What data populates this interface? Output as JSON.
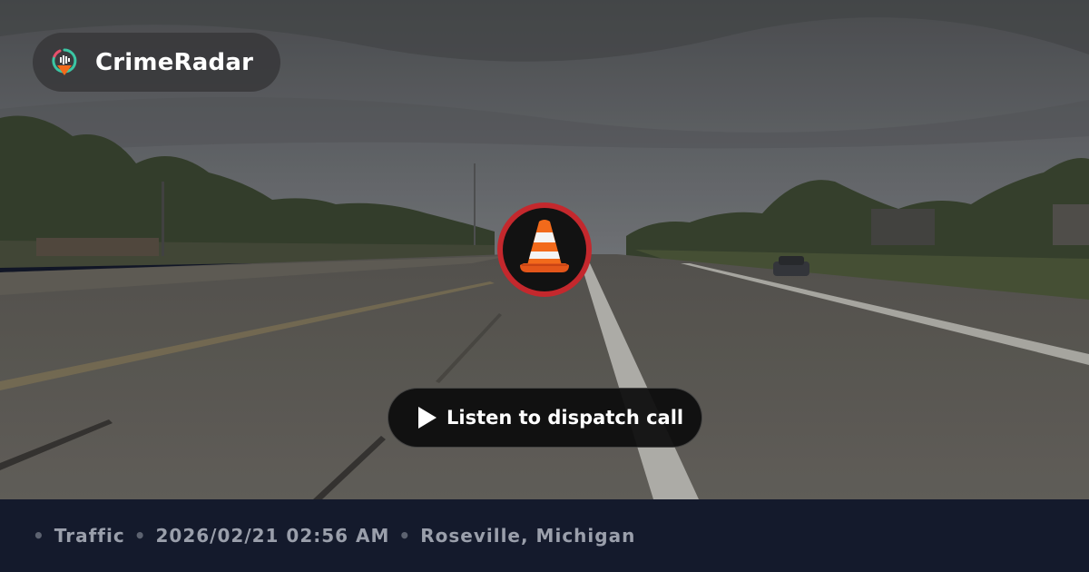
{
  "brand": {
    "name": "CrimeRadar",
    "logo_icon": "radar-pin-icon"
  },
  "incident": {
    "category_icon": "traffic-cone-icon",
    "category": "Traffic",
    "datetime": "2026/02/21 02:56 AM",
    "location": "Roseville, Michigan",
    "separator": "•"
  },
  "player": {
    "label": "Listen to dispatch call",
    "icon": "play-icon"
  },
  "colors": {
    "badge_ring": "#c4282d",
    "info_bar_bg": "#141a2c",
    "cone_orange": "#f26a1b"
  }
}
